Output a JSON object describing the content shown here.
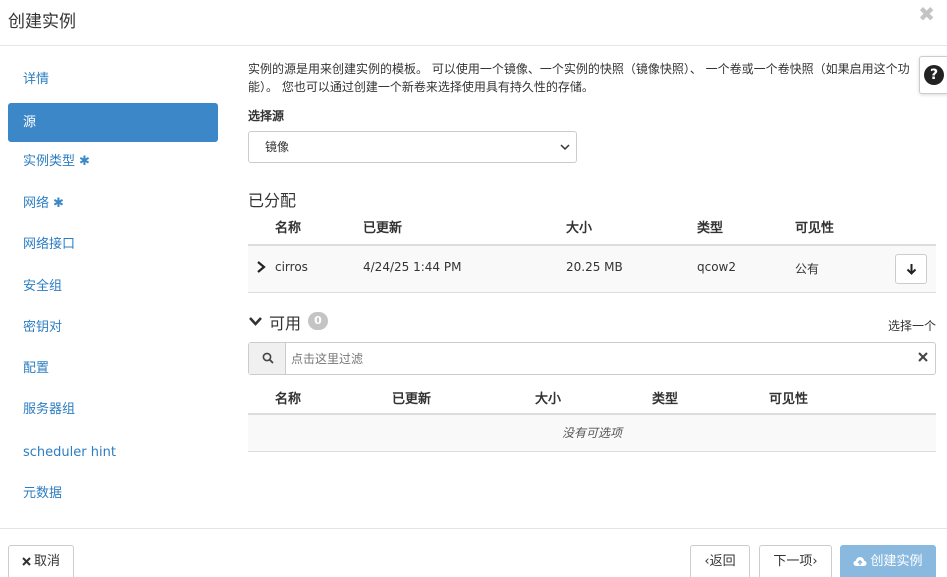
{
  "dialog": {
    "title": "创建实例",
    "close_glyph": "✖"
  },
  "sidebar": {
    "items": [
      {
        "label": "详情",
        "required": false,
        "active": false
      },
      {
        "label": "源",
        "required": false,
        "active": true
      },
      {
        "label": "实例类型",
        "required": true,
        "active": false
      },
      {
        "label": "网络",
        "required": true,
        "active": false
      },
      {
        "label": "网络接口",
        "required": false,
        "active": false
      },
      {
        "label": "安全组",
        "required": false,
        "active": false
      },
      {
        "label": "密钥对",
        "required": false,
        "active": false
      },
      {
        "label": "配置",
        "required": false,
        "active": false
      },
      {
        "label": "服务器组",
        "required": false,
        "active": false
      },
      {
        "label": "scheduler hint",
        "required": false,
        "active": false
      },
      {
        "label": "元数据",
        "required": false,
        "active": false
      }
    ],
    "required_mark": "✱"
  },
  "source": {
    "description": "实例的源是用来创建实例的模板。 可以使用一个镜像、一个实例的快照（镜像快照）、 一个卷或一个卷快照（如果启用这个功能）。 您也可以通过创建一个新卷来选择使用具有持久性的存储。",
    "help_glyph": "?",
    "select_label": "选择源",
    "select_value": "镜像"
  },
  "allocated": {
    "title": "已分配",
    "columns": [
      "名称",
      "已更新",
      "大小",
      "类型",
      "可见性"
    ],
    "rows": [
      {
        "name": "cirros",
        "updated": "4/24/25 1:44 PM",
        "size": "20.25 MB",
        "type": "qcow2",
        "visibility": "公有"
      }
    ]
  },
  "available": {
    "title": "可用",
    "count": "0",
    "choose_hint": "选择一个",
    "filter_placeholder": "点击这里过滤",
    "columns": [
      "名称",
      "已更新",
      "大小",
      "类型",
      "可见性"
    ],
    "empty_text": "没有可选项"
  },
  "footer": {
    "cancel_label": "取消",
    "back_label": "‹返回",
    "next_label": "下一项›",
    "create_label": "创建实例"
  },
  "colors": {
    "accent": "#3c87c8",
    "link": "#2c7ec2",
    "create_button": "#8ab9e0",
    "badge": "#c4c4c4"
  },
  "icons": {
    "close": "close-icon",
    "help": "question-circle-icon",
    "expand": "chevron-right-icon",
    "allocate_remove": "arrow-down-icon",
    "section_toggle": "chevron-down-icon",
    "search": "search-icon",
    "clear": "clear-x-icon",
    "cancel": "x-icon",
    "create": "cloud-upload-icon"
  }
}
